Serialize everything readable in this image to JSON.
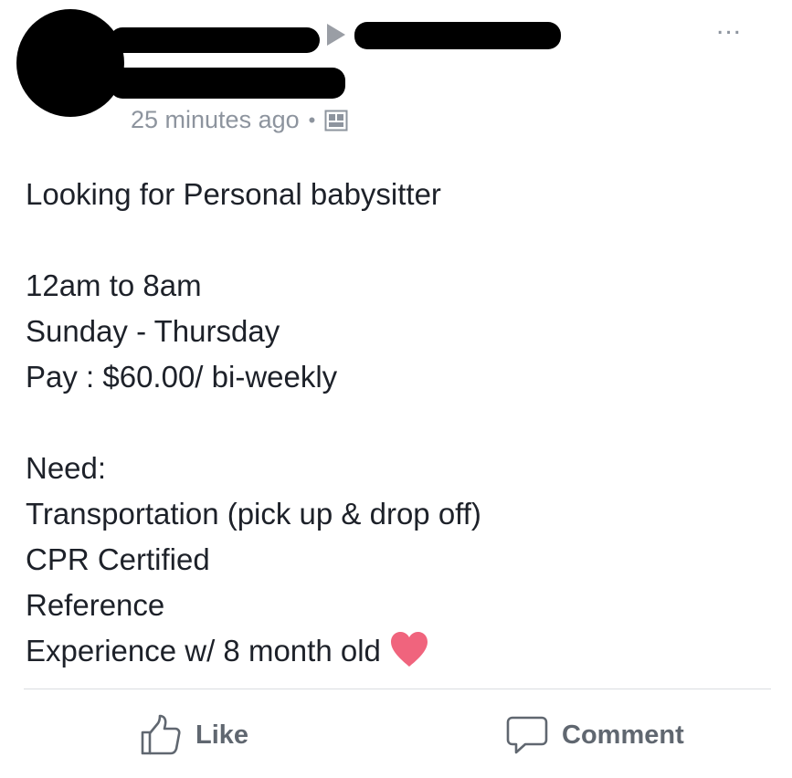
{
  "post": {
    "header": {
      "timestamp": "25 minutes ago",
      "separator": "•",
      "audience_icon": "public-audience-icon",
      "more_label": "..."
    },
    "body": {
      "lines": [
        "Looking for Personal babysitter",
        "",
        "12am to 8am",
        "Sunday - Thursday",
        "Pay : $60.00/ bi-weekly",
        "",
        "Need:",
        "Transportation (pick up & drop off)",
        "CPR Certified",
        "Reference",
        "Experience w/ 8 month old"
      ],
      "emoji": "heart-icon",
      "emoji_color": "#f0647d"
    },
    "actions": {
      "like_label": "Like",
      "comment_label": "Comment"
    }
  },
  "colors": {
    "text": "#1d2129",
    "meta": "#8d949e",
    "action": "#606770",
    "divider": "#dadde1"
  }
}
